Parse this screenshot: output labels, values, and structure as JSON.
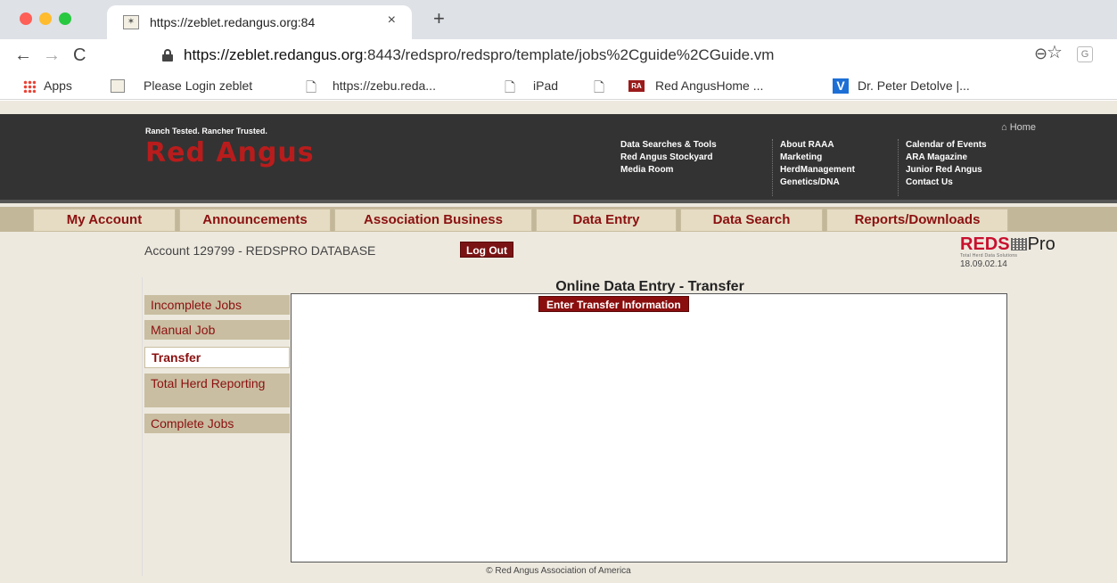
{
  "browser": {
    "tab_title": "https://zeblet.redangus.org:84",
    "tab_close": "×",
    "new_tab": "+",
    "url_host": "https://zeblet.redangus.org",
    "url_rest": ":8443/redspro/redspro/template/jobs%2Cguide%2CGuide.vm",
    "nav_back": "←",
    "nav_forward": "→",
    "nav_reload": "C",
    "zoom_glyph": "⊖",
    "star_glyph": "☆",
    "extension_label": "G",
    "bookmarks": [
      {
        "label": "Apps"
      },
      {
        "label": "Please Login zeblet"
      },
      {
        "label": "https://zebu.reda..."
      },
      {
        "label": "iPad"
      },
      {
        "label": "Red AngusHome ..."
      },
      {
        "label": "Dr. Peter Detolve |..."
      }
    ],
    "ra_badge": "RA",
    "v_badge": "V"
  },
  "header": {
    "tagline": "Ranch Tested. Rancher Trusted.",
    "logo": "Red Angus",
    "home_link": "⌂ Home",
    "columns": [
      [
        "Data Searches & Tools",
        "Red Angus Stockyard",
        "Media Room"
      ],
      [
        "About RAAA",
        "Marketing",
        "HerdManagement",
        "Genetics/DNA"
      ],
      [
        "Calendar of Events",
        "ARA Magazine",
        "Junior Red Angus",
        "Contact Us"
      ]
    ]
  },
  "nav_tabs": [
    "My Account",
    "Announcements",
    "Association Business",
    "Data Entry",
    "Data Search",
    "Reports/Downloads"
  ],
  "account": {
    "text": "Account 129799 - REDSPRO DATABASE",
    "logout": "Log Out"
  },
  "redspro": {
    "reds": "REDS",
    "pro": "Pro",
    "subtitle": "Total Herd Data Solutions",
    "version": "18.09.02.14"
  },
  "sidebar": {
    "items": [
      {
        "label": "Incomplete Jobs",
        "active": false
      },
      {
        "label": "Manual Job",
        "active": false
      },
      {
        "label": "Transfer",
        "active": true
      },
      {
        "label": "Total Herd Reporting",
        "active": false
      },
      {
        "label": "Complete Jobs",
        "active": false
      }
    ]
  },
  "content": {
    "title": "Online Data Entry - Transfer",
    "button": "Enter Transfer Information"
  },
  "footer": "© Red Angus Association of America",
  "colors": {
    "brand_red": "#b91c1c",
    "header_bg": "#333333",
    "tab_text": "#8b1010",
    "page_bg": "#ede9df"
  }
}
